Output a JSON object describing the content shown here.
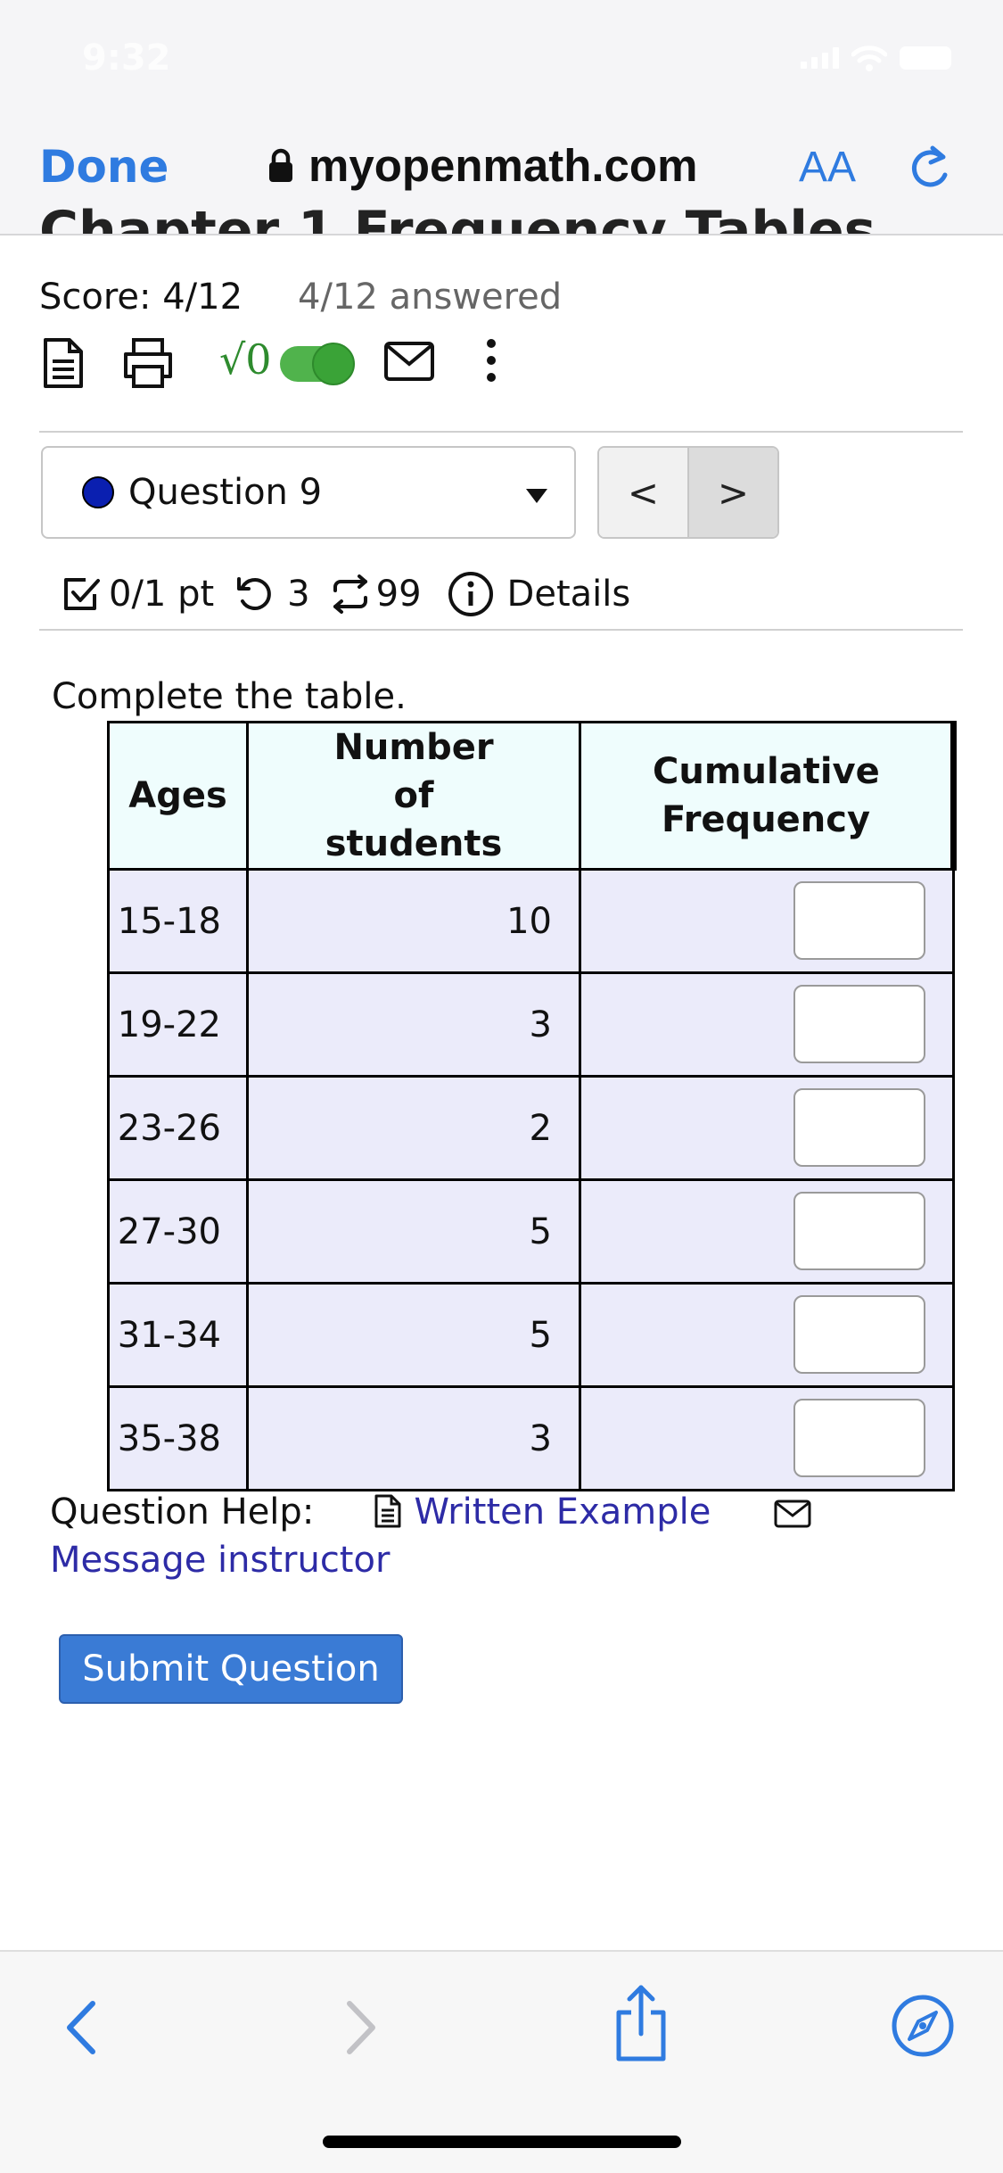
{
  "status_bar": {
    "time": "9:32"
  },
  "browser": {
    "done_label": "Done",
    "url": "myopenmath.com",
    "text_size_label": "AA",
    "partial_title": "Chapter 1 Frequency Tables"
  },
  "assignment": {
    "score": "Score: 4/12",
    "answered": "4/12 answered",
    "math_toggle_label": "√0"
  },
  "question_nav": {
    "selected": "Question 9",
    "prev_label": "<",
    "next_label": ">"
  },
  "meta": {
    "points": "0/1 pt",
    "retries": "3",
    "regens": "99",
    "details": "Details"
  },
  "question": {
    "instruction": "Complete the table.",
    "headers": [
      "Ages",
      "Number of students",
      "Cumulative Frequency"
    ],
    "rows": [
      {
        "age": "15-18",
        "count": "10",
        "cumulative": ""
      },
      {
        "age": "19-22",
        "count": "3",
        "cumulative": ""
      },
      {
        "age": "23-26",
        "count": "2",
        "cumulative": ""
      },
      {
        "age": "27-30",
        "count": "5",
        "cumulative": ""
      },
      {
        "age": "31-34",
        "count": "5",
        "cumulative": ""
      },
      {
        "age": "35-38",
        "count": "3",
        "cumulative": ""
      }
    ]
  },
  "help": {
    "label": "Question Help:",
    "written_example": "Written Example",
    "message_instructor": "Message instructor"
  },
  "submit_label": "Submit Question",
  "colors": {
    "accent": "#2f7be0",
    "submit": "#3a7bd5",
    "link": "#2d2ba6",
    "toggle_on": "#50b34c",
    "header_bg": "#effdfd",
    "cell_bg": "#ebebfa",
    "question_dot": "#0a1fb0"
  },
  "icons": {
    "lock": "lock-icon",
    "reload": "reload-icon",
    "document": "document-icon",
    "printer": "printer-icon",
    "mail": "mail-icon",
    "more": "kebab-icon",
    "checkbox": "checkbox-icon",
    "retry": "retry-icon",
    "regenerate": "regenerate-icon",
    "info": "info-icon",
    "back": "back-icon",
    "forward": "forward-icon",
    "share": "share-icon",
    "compass": "compass-icon"
  }
}
